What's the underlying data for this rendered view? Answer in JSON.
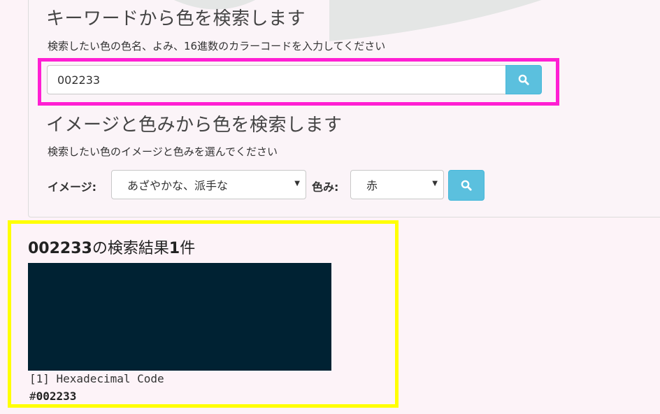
{
  "colors": {
    "page_bg": "#fdf3f8",
    "panel_bg": "#fbf4f8",
    "accent": "#5bc0de",
    "highlight_magenta": "#ff1fd3",
    "highlight_yellow": "#ffff00",
    "swatch": "#002233"
  },
  "keyword_search": {
    "heading": "キーワードから色を検索します",
    "help": "検索したい色の色名、よみ、16進数のカラーコードを入力してください",
    "input_value": "002233",
    "button_icon": "search-icon"
  },
  "image_search": {
    "heading": "イメージと色みから色を検索します",
    "help": "検索したい色のイメージと色みを選んでください",
    "image_label": "イメージ:",
    "image_selected": "あざやかな、派手な",
    "hue_label": "色み:",
    "hue_selected": "赤",
    "button_icon": "search-icon"
  },
  "result": {
    "query": "002233",
    "title_middle": "の検索結果",
    "count": "1",
    "count_suffix": "件",
    "swatch_color": "#002233",
    "code_label": "[1] Hexadecimal Code",
    "code_hash": "#",
    "code_value": "002233"
  }
}
